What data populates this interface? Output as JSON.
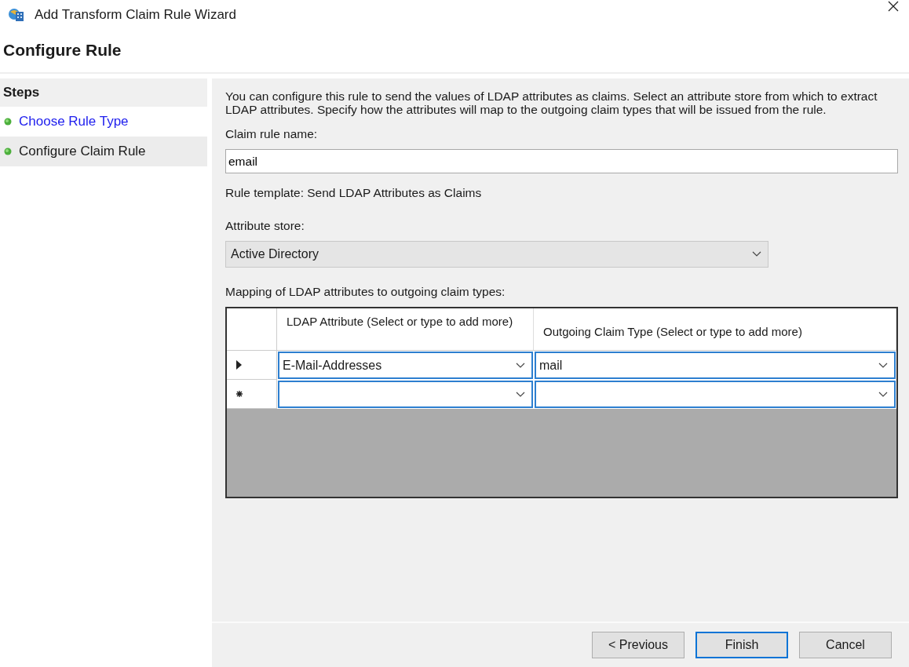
{
  "window": {
    "title": "Add Transform Claim Rule Wizard"
  },
  "page_title": "Configure Rule",
  "steps": {
    "heading": "Steps",
    "items": [
      {
        "label": "Choose Rule Type",
        "selected": false
      },
      {
        "label": "Configure Claim Rule",
        "selected": true
      }
    ]
  },
  "description": "You can configure this rule to send the values of LDAP attributes as claims. Select an attribute store from which to extract LDAP attributes. Specify how the attributes will map to the outgoing claim types that will be issued from the rule.",
  "claim_rule_name": {
    "label": "Claim rule name:",
    "value": "email"
  },
  "rule_template": "Rule template: Send LDAP Attributes as Claims",
  "attribute_store": {
    "label": "Attribute store:",
    "value": "Active Directory"
  },
  "mapping": {
    "label": "Mapping of LDAP attributes to outgoing claim types:",
    "columns": [
      "LDAP Attribute (Select or type to add more)",
      "Outgoing Claim Type (Select or type to add more)"
    ],
    "rows": [
      {
        "kind": "current",
        "cells": [
          "E-Mail-Addresses",
          "mail"
        ]
      },
      {
        "kind": "new",
        "cells": [
          "",
          ""
        ]
      }
    ]
  },
  "buttons": [
    {
      "label": "< Previous",
      "default": false
    },
    {
      "label": "Finish",
      "default": true
    },
    {
      "label": "Cancel",
      "default": false
    }
  ]
}
